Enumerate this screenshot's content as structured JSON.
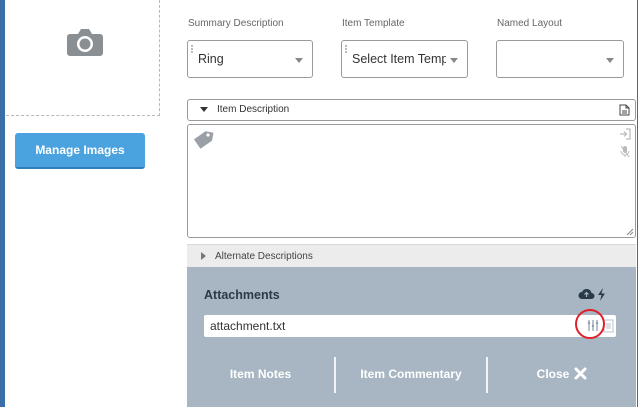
{
  "left": {
    "manage_images_label": "Manage Images"
  },
  "fields": [
    {
      "label": "Summary Description",
      "value": "Ring"
    },
    {
      "label": "Item Template",
      "value": "Select Item Temp"
    },
    {
      "label": "Named Layout",
      "value": ""
    }
  ],
  "item_description": {
    "header": "Item Description",
    "text": ""
  },
  "alternate_descriptions": {
    "header": "Alternate Descriptions"
  },
  "attachments": {
    "title": "Attachments",
    "file_name": "attachment.txt"
  },
  "bottom_tabs": [
    {
      "label": "Item Notes"
    },
    {
      "label": "Item Commentary"
    },
    {
      "label": "Close"
    }
  ],
  "colors": {
    "accent_button": "#4aa3de",
    "panel": "#a7b6c2",
    "highlight_circle": "#e0202a"
  },
  "icons": [
    "camera-icon",
    "document-icon",
    "tag-icon",
    "login-icon",
    "mic-off-icon",
    "cloud-upload-icon",
    "bolt-icon",
    "grip-icon",
    "copy-icon",
    "close-x-icon"
  ]
}
